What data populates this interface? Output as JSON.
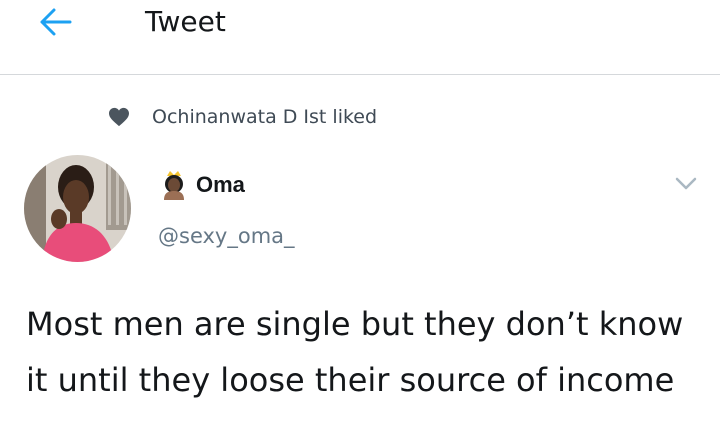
{
  "header": {
    "back_icon": "arrow-left-icon",
    "title": "Tweet"
  },
  "social_context": {
    "icon": "heart-icon",
    "text": "Ochinanwata D Ist liked"
  },
  "tweet": {
    "author": {
      "emoji_icon": "princess-emoji-icon",
      "display_name": "Oma",
      "handle": "@sexy_oma_"
    },
    "menu_icon": "chevron-down-icon",
    "text": "Most men are single but they don’t know it until they loose their source of income"
  },
  "colors": {
    "accent": "#1da1f2",
    "text_primary": "#14171a",
    "text_secondary": "#657786",
    "divider": "#d5d8db"
  }
}
